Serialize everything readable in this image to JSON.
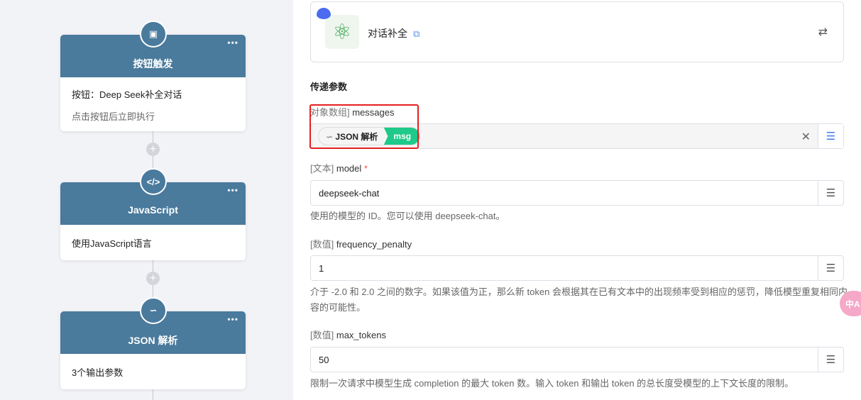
{
  "flow": {
    "nodes": [
      {
        "title": "按钮触发",
        "icon": "button-click-icon",
        "lines": [
          "按钮：Deep Seek补全对话",
          "点击按钮后立即执行"
        ]
      },
      {
        "title": "JavaScript",
        "icon": "code-icon",
        "lines": [
          "使用JavaScript语言"
        ]
      },
      {
        "title": "JSON 解析",
        "icon": "link-icon",
        "lines": [
          "3个输出参数"
        ]
      }
    ],
    "more": "•••",
    "add": "+"
  },
  "panel": {
    "action": {
      "title": "对话补全",
      "logo": "atom-icon",
      "link_icon": "external-link-icon",
      "switch_icon": "swap-icon"
    },
    "section_title": "传递参数",
    "params": [
      {
        "type": "对象数组]",
        "name": "messages",
        "chip_source": "JSON 解析",
        "chip_value": "msg"
      },
      {
        "type": "[文本]",
        "name": "model",
        "required": "*",
        "value": "deepseek-chat",
        "help": "使用的模型的 ID。您可以使用 deepseek-chat。"
      },
      {
        "type": "[数值]",
        "name": "frequency_penalty",
        "value": "1",
        "help": "介于 -2.0 和 2.0 之间的数字。如果该值为正，那么新 token 会根据其在已有文本中的出现频率受到相应的惩罚，降低模型重复相同内容的可能性。"
      },
      {
        "type": "[数值]",
        "name": "max_tokens",
        "value": "50",
        "help": "限制一次请求中模型生成 completion 的最大 token 数。输入 token 和输出 token 的总长度受模型的上下文长度的限制。"
      }
    ],
    "translate": "中A"
  },
  "colors": {
    "node_header": "#4a7a9c",
    "chip_green": "#1ec98a",
    "highlight": "#e52020"
  }
}
